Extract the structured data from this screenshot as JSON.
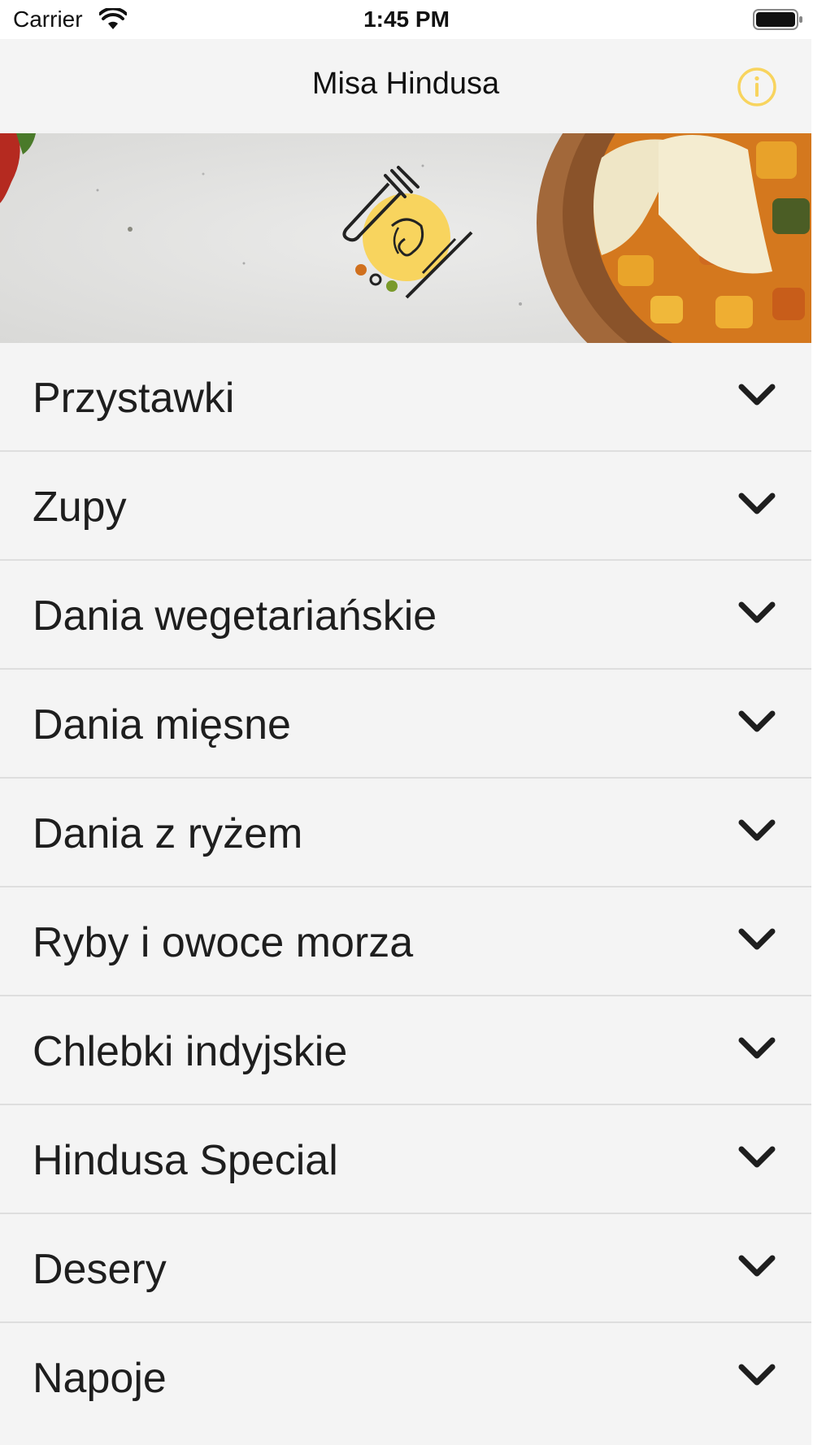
{
  "status_bar": {
    "carrier": "Carrier",
    "time": "1:45 PM",
    "icons": [
      "wifi-icon",
      "battery-icon"
    ]
  },
  "nav_bar": {
    "title": "Misa Hindusa",
    "info_icon": "info-icon",
    "accent_color": "#f8d45e"
  },
  "banner": {
    "image": "food-banner-with-logo",
    "logo_color": "#f8d45e"
  },
  "menu": {
    "items": [
      {
        "label": "Przystawki"
      },
      {
        "label": "Zupy"
      },
      {
        "label": "Dania wegetariańskie"
      },
      {
        "label": "Dania mięsne"
      },
      {
        "label": "Dania z ryżem"
      },
      {
        "label": "Ryby i owoce morza"
      },
      {
        "label": "Chlebki indyjskie"
      },
      {
        "label": "Hindusa Special"
      },
      {
        "label": "Desery"
      },
      {
        "label": "Napoje"
      }
    ],
    "expand_icon": "chevron-down-icon"
  }
}
